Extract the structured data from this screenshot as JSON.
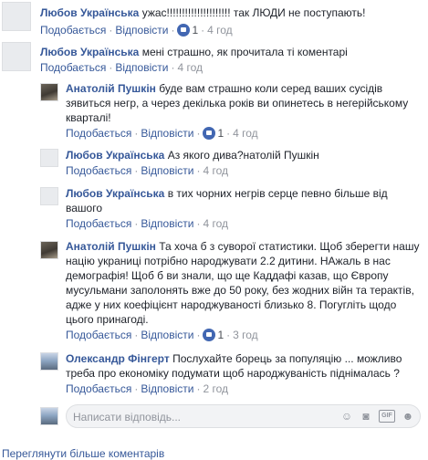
{
  "actions": {
    "like": "Подобається",
    "reply": "Відповісти"
  },
  "comments": [
    {
      "author": "Любов Українська",
      "text": "ужас!!!!!!!!!!!!!!!!!!!!! так ЛЮДИ не поступають!",
      "likes": "1",
      "time": "4 год"
    },
    {
      "author": "Любов Українська",
      "text": "мені страшно, як прочитала ті коментарі",
      "time": "4 год"
    }
  ],
  "replies": [
    {
      "author": "Анатолій Пушкін",
      "text": "буде вам страшно коли серед ваших сусідів зявиться негр, а через декілька років ви опинетесь в негерійському кварталі!",
      "likes": "1",
      "time": "4 год"
    },
    {
      "author": "Любов Українська",
      "text": "Аз якого дива?натолій Пушкін",
      "time": "4 год"
    },
    {
      "author": "Любов Українська",
      "text": "в тих чорних негрів серце певно більше від вашого",
      "time": "4 год"
    },
    {
      "author": "Анатолій Пушкін",
      "text": "Та хоча б з суворої статистики. Щоб зберегти нашу націю украниці потрібно народжувати 2.2 дитини. НАжаль в нас демографія! Щоб б ви знали, що ще Каддафі казав, що Європу мусульмани заполонять вже до 50 року, без жодних війн та терактів, адже у них коефіцієнт народжуваності близько 8. Погугліть щодо цього принагоді.",
      "likes": "1",
      "time": "3 год"
    },
    {
      "author": "Олександр Фінгерт",
      "text": "Послухайте борець за популяцію ... можливо треба про економіку подумати щоб народжуваність піднімалась ?",
      "time": "2 год"
    }
  ],
  "reply_box": {
    "placeholder": "Написати відповідь..."
  },
  "more_comments": "Переглянути більше коментарів"
}
